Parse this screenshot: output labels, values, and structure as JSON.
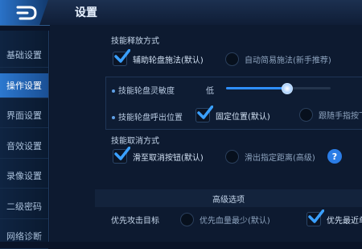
{
  "header": {
    "title": "设置"
  },
  "sidebar": {
    "items": [
      {
        "label": "基础设置"
      },
      {
        "label": "操作设置",
        "active": true
      },
      {
        "label": "界面设置"
      },
      {
        "label": "音效设置"
      },
      {
        "label": "录像设置"
      },
      {
        "label": "二级密码"
      },
      {
        "label": "网络诊断"
      }
    ]
  },
  "release": {
    "title": "技能释放方式",
    "option_assist": {
      "label": "辅助轮盘施法(默认)",
      "checked": true
    },
    "option_auto": {
      "label": "自动简易施法(新手推荐)",
      "checked": false
    }
  },
  "wheel": {
    "sensitivity_label": "技能轮盘灵敏度",
    "sensitivity_value_label": "低",
    "sensitivity_level": 0.58,
    "position_label": "技能轮盘呼出位置",
    "option_fixed": {
      "label": "固定位置(默认)",
      "checked": true
    },
    "option_follow": {
      "label": "跟随手指按下",
      "checked": false
    }
  },
  "cancel": {
    "title": "技能取消方式",
    "option_button": {
      "label": "滑至取消按钮(默认)",
      "checked": true
    },
    "option_distance": {
      "label": "滑出指定距离(高级)",
      "checked": false
    },
    "help_glyph": "?"
  },
  "advanced": {
    "title": "高级选项",
    "priority_label": "优先攻击目标",
    "option_low_hp": {
      "label": "优先血量最少(默认)",
      "checked": false
    },
    "option_nearest": {
      "label": "优先最近单",
      "checked": true
    }
  },
  "colors": {
    "accent": "#2f8fff",
    "active_tab": "#2c78cf",
    "check": "#3aa0ff"
  }
}
